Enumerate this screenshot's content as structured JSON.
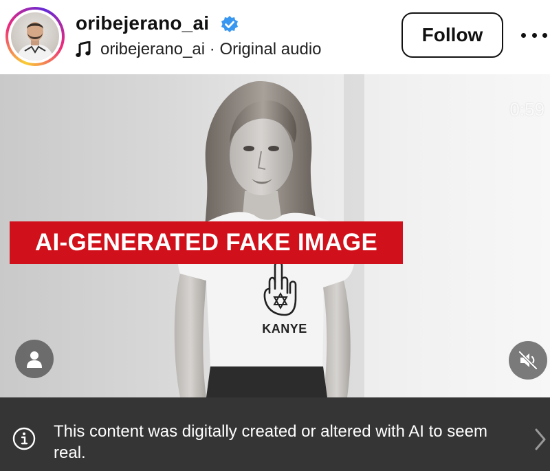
{
  "header": {
    "username": "oribejerano_ai",
    "audio_label": "oribejerano_ai · Original audio",
    "follow_label": "Follow"
  },
  "media": {
    "timer": "0:59",
    "banner_text": "AI-GENERATED FAKE IMAGE",
    "shirt_text": "KANYE"
  },
  "notice": {
    "text": "This content was digitally created or altered with AI to seem real."
  },
  "colors": {
    "banner_red": "#d0101a",
    "verified_blue": "#3897f0",
    "notice_bg": "#353536"
  },
  "icons": [
    "verified-badge-icon",
    "music-note-icon",
    "more-options-icon",
    "user-icon",
    "mute-icon",
    "info-icon",
    "chevron-right-icon"
  ]
}
